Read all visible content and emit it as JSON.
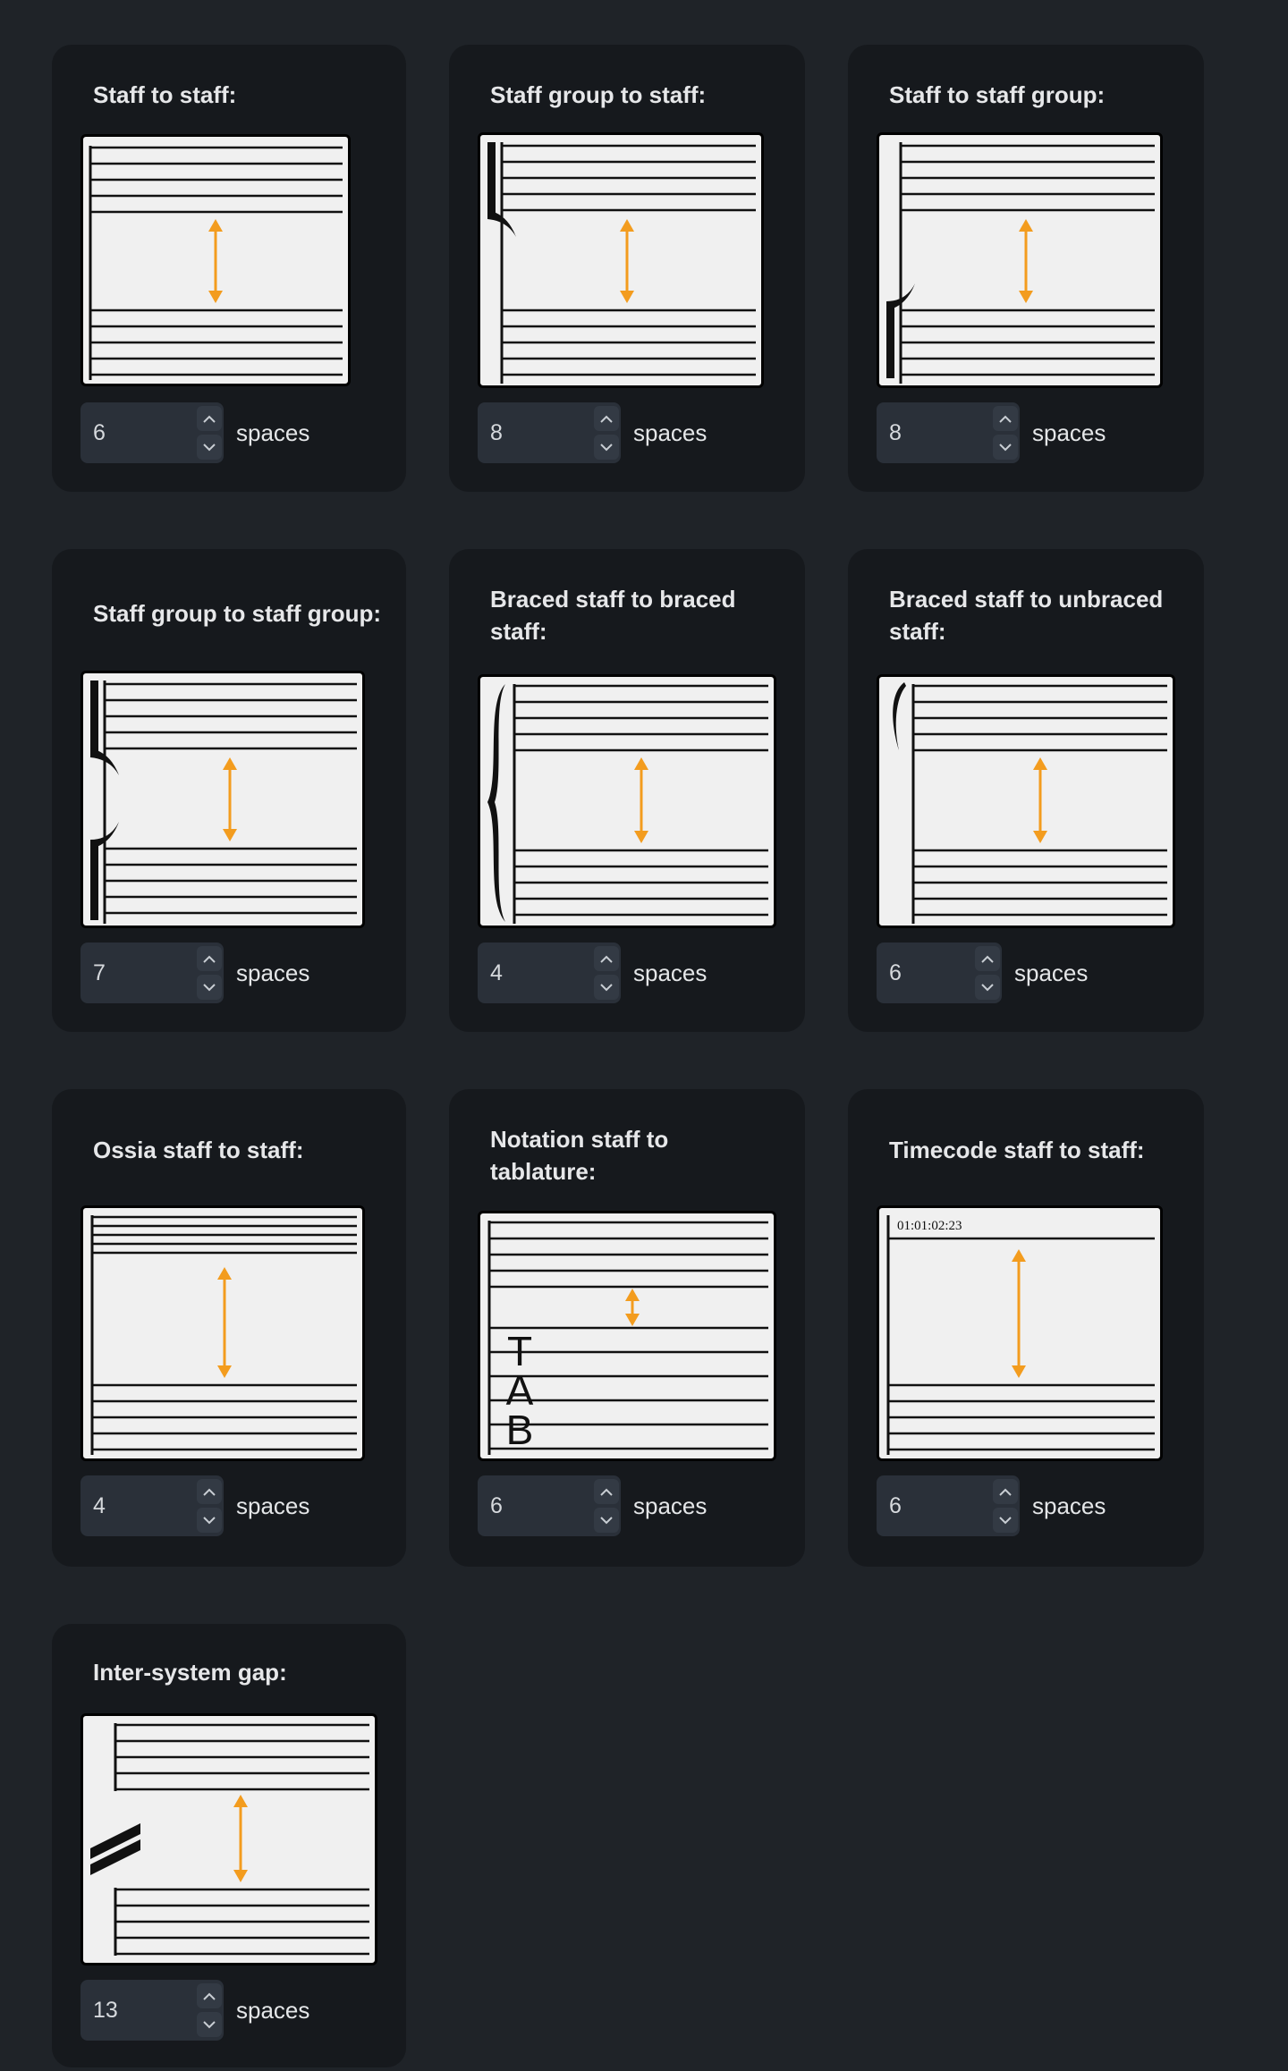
{
  "unit_label": "spaces",
  "accent_color": "#f39c1e",
  "cards": [
    {
      "id": "staff-to-staff",
      "title": "Staff to staff:",
      "value": "6"
    },
    {
      "id": "staff-group-to-staff",
      "title": "Staff group to staff:",
      "value": "8"
    },
    {
      "id": "staff-to-staff-group",
      "title": "Staff to staff group:",
      "value": "8"
    },
    {
      "id": "staff-group-to-staff-group",
      "title": "Staff group to staff group:",
      "value": "7"
    },
    {
      "id": "braced-to-braced",
      "title": "Braced staff to braced staff:",
      "value": "4"
    },
    {
      "id": "braced-to-unbraced",
      "title": "Braced staff to unbraced staff:",
      "value": "6"
    },
    {
      "id": "ossia-to-staff",
      "title": "Ossia staff to staff:",
      "value": "4"
    },
    {
      "id": "notation-to-tab",
      "title": "Notation staff to tablature:",
      "value": "6",
      "tab_letters": [
        "T",
        "A",
        "B"
      ]
    },
    {
      "id": "timecode-to-staff",
      "title": "Timecode staff to staff:",
      "value": "6",
      "timecode": "01:01:02:23"
    },
    {
      "id": "inter-system-gap",
      "title": "Inter-system gap:",
      "value": "13"
    }
  ]
}
